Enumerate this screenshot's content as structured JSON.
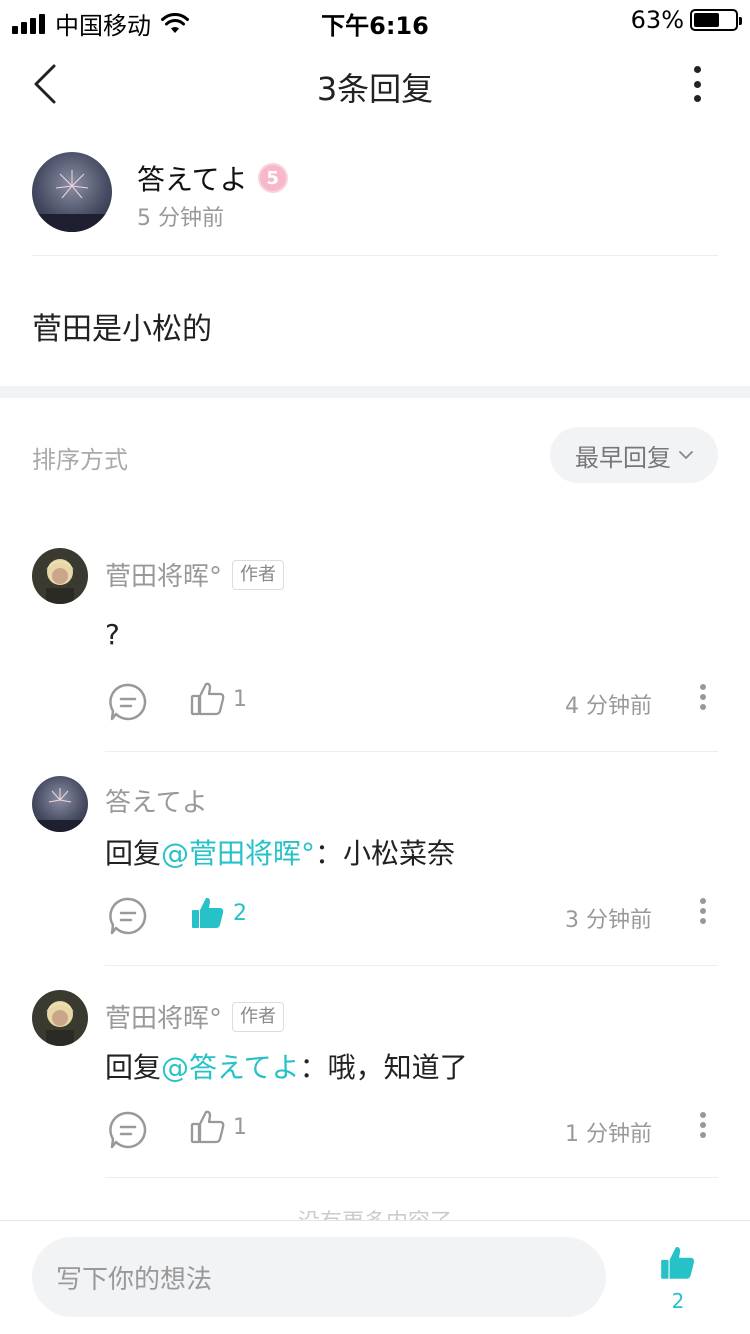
{
  "status_bar": {
    "carrier": "中国移动",
    "time": "下午6:16",
    "battery_percent": "63%",
    "battery_level": 0.63
  },
  "nav": {
    "title": "3条回复"
  },
  "post": {
    "author": "答えてよ",
    "level": "5",
    "time": "5 分钟前",
    "text": "菅田是小松的"
  },
  "sort": {
    "label": "排序方式",
    "selected": "最早回复"
  },
  "comments": [
    {
      "author": "菅田将晖°",
      "tag": "作者",
      "text": "?",
      "likes": "1",
      "liked": false,
      "time": "4 分钟前"
    },
    {
      "author": "答えてよ",
      "reply_prefix": "回复",
      "mention": "@菅田将晖°",
      "text": "：小松菜奈",
      "likes": "2",
      "liked": true,
      "time": "3 分钟前"
    },
    {
      "author": "菅田将晖°",
      "tag": "作者",
      "reply_prefix": "回复",
      "mention": "@答えてよ",
      "text": "：哦，知道了",
      "likes": "1",
      "liked": false,
      "time": "1 分钟前"
    }
  ],
  "no_more_text": "没有更多内容了",
  "bottom": {
    "input_placeholder": "写下你的想法",
    "like_count": "2"
  },
  "colors": {
    "accent": "#27c2c8",
    "muted": "#999999",
    "background_gray": "#f2f3f5"
  },
  "icons": {
    "back": "chevron-left-icon",
    "more": "more-vertical-icon",
    "reply": "comment-bubble-icon",
    "like": "thumbs-up-icon"
  }
}
